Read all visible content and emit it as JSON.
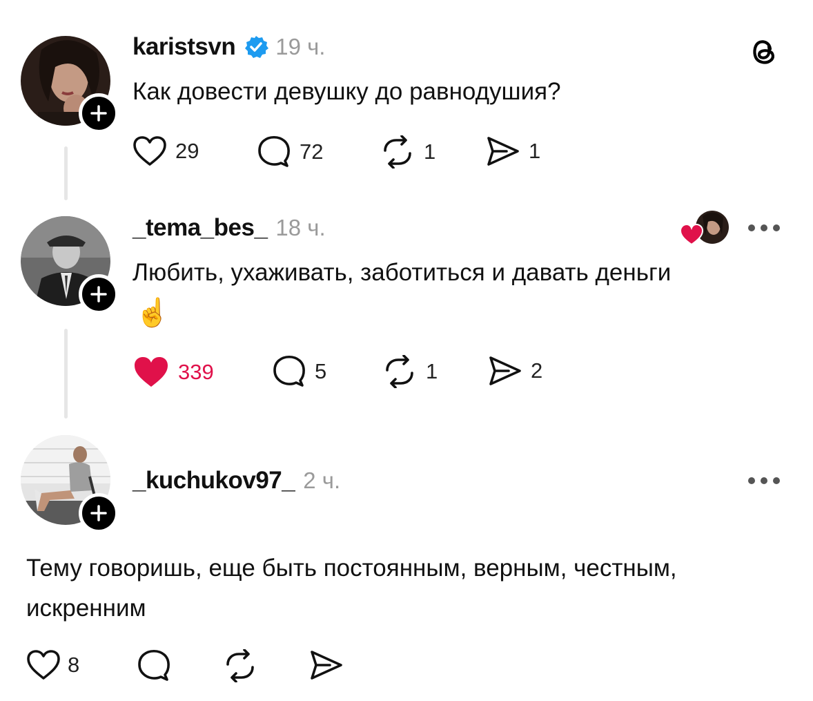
{
  "posts": [
    {
      "username": "karistsvn",
      "time": "19 ч.",
      "verified": true,
      "text": "Как довести девушку до равнодушия?",
      "likes": "29",
      "replies": "72",
      "reposts": "1",
      "shares": "1"
    },
    {
      "username": "_tema_bes_",
      "time": "18 ч.",
      "text": "Любить, ухаживать, заботиться и давать деньги",
      "emoji": "☝️",
      "likes": "339",
      "liked": true,
      "replies": "5",
      "reposts": "1",
      "shares": "2"
    },
    {
      "username": "_kuchukov97_",
      "time": "2 ч.",
      "text_line1": "Тему говоришь, еще быть постоянным, верным, честным,",
      "text_line2": "искренним",
      "likes": "8"
    }
  ],
  "colors": {
    "verified": "#1d9bf0",
    "liked": "#e0114a",
    "thread_line": "#e6e6e6",
    "muted": "#9a9a9a"
  },
  "icons": {
    "app_logo": "threads-logo-icon",
    "like": "heart-icon",
    "reply": "speech-bubble-icon",
    "repost": "repost-icon",
    "share": "send-icon",
    "more": "more-dots-icon"
  }
}
